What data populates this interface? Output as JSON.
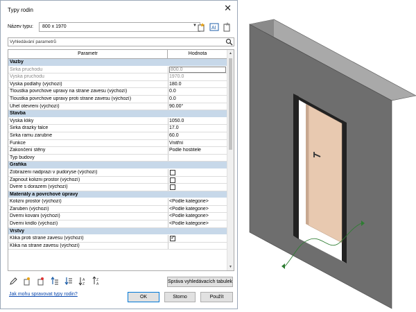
{
  "dialog": {
    "title": "Typy rodin",
    "close_symbol": "✕"
  },
  "type": {
    "label": "Název typu:",
    "selected": "800 x 1970"
  },
  "search": {
    "placeholder": "Vyhledávání parametrů"
  },
  "grid": {
    "col_param": "Parametr",
    "col_value": "Hodnota",
    "rows": [
      {
        "kind": "group",
        "param": "Vazby"
      },
      {
        "kind": "row",
        "param": "Sirka pruchodu",
        "value": "800.0",
        "dim": true,
        "boxed": true
      },
      {
        "kind": "row",
        "param": "Vyska pruchodu",
        "value": "1970.0",
        "dim": true
      },
      {
        "kind": "row",
        "param": "Vyska podlahy (výchozí)",
        "value": "180.0"
      },
      {
        "kind": "row",
        "param": "Tloustka povrchove upravy na strane zavesu (výchozí)",
        "value": "0.0"
      },
      {
        "kind": "row",
        "param": "Tloustka povrchove upravy proti strane zavesu (výchozí)",
        "value": "0.0"
      },
      {
        "kind": "row",
        "param": "Uhel otevreni (výchozí)",
        "value": "90.00°"
      },
      {
        "kind": "group",
        "param": "Stavba"
      },
      {
        "kind": "row",
        "param": "Vyska kliky",
        "value": "1050.0"
      },
      {
        "kind": "row",
        "param": "Sirka drazky falce",
        "value": "17.0"
      },
      {
        "kind": "row",
        "param": "Sirka ramu zarubne",
        "value": "60.0"
      },
      {
        "kind": "row",
        "param": "Funkce",
        "value": "Vnitřní"
      },
      {
        "kind": "row",
        "param": "Zakončení stěny",
        "value": "Podle hostitele"
      },
      {
        "kind": "row",
        "param": "Typ budovy",
        "value": ""
      },
      {
        "kind": "group",
        "param": "Grafika"
      },
      {
        "kind": "check",
        "param": "Zobrazeni nadprazi v pudoryse (výchozí)",
        "checked": false
      },
      {
        "kind": "check",
        "param": "Zapnout kolizni prostor (výchozí)",
        "checked": false
      },
      {
        "kind": "check",
        "param": "Dvere s dorazem (výchozí)",
        "checked": false
      },
      {
        "kind": "group",
        "param": "Materiály a povrchové úpravy"
      },
      {
        "kind": "row",
        "param": "Kolizni prostor (výchozí)",
        "value": "<Podle kategorie>"
      },
      {
        "kind": "row",
        "param": "Zaruben (výchozí)",
        "value": "<Podle kategorie>"
      },
      {
        "kind": "row",
        "param": "Dverni kovani (výchozí)",
        "value": "<Podle kategorie>"
      },
      {
        "kind": "row",
        "param": "Dverni kridlo (výchozí)",
        "value": "<Podle kategorie>"
      },
      {
        "kind": "group",
        "param": "Vrstvy"
      },
      {
        "kind": "check",
        "param": "Klika proti strane zavesu (výchozí)",
        "checked": true
      },
      {
        "kind": "row",
        "param": "Klika na strane zavesu (výchozí)",
        "value": ""
      }
    ]
  },
  "buttons": {
    "manage_lookup": "Správa vyhledávacích tabulek",
    "ok": "OK",
    "cancel": "Storno",
    "apply": "Použít"
  },
  "help_link": "Jak mohu spravovat typy rodin?",
  "colors": {
    "group_band": "#c7d8e9",
    "wall": "#6e6e6e",
    "door_leaf": "#e8c9b0",
    "frame": "#222222",
    "path": "#2e7d32"
  }
}
